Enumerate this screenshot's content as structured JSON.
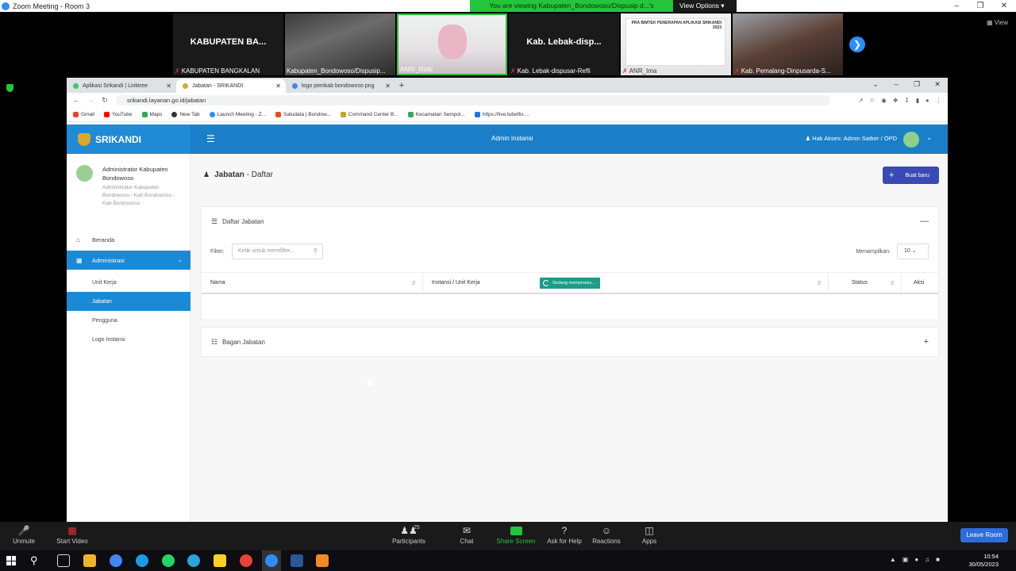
{
  "zoom": {
    "title": "Zoom Meeting - Room 3",
    "share_banner": "You are viewing Kabupaten_Bondowoso/Dispusip d...'s screen",
    "view_options": "View Options",
    "view_label": "View",
    "participants": [
      {
        "big_label": "KABUPATEN BA...",
        "caption": "KABUPATEN BANGKALAN"
      },
      {
        "big_label": "",
        "caption": "Kabupaten_Bondowoso/Dispusip..."
      },
      {
        "big_label": "",
        "caption": "ANRI_Rizki"
      },
      {
        "big_label": "Kab.  Lebak-disp...",
        "caption": "Kab. Lebak-dispusar-Refli"
      },
      {
        "big_label": "",
        "caption": "ANR_Ima"
      },
      {
        "big_label": "",
        "caption": "Kab. Pemalang-Dinpusarda-S..."
      }
    ],
    "poster_text": "PRA BIMTEK PENERAPAN APLIKASI SRIKANDI 2023",
    "toolbar": {
      "unmute": "Unmute",
      "start_video": "Start Video",
      "participants": "Participants",
      "participants_count": "25",
      "chat": "Chat",
      "share_screen": "Share Screen",
      "ask_for_help": "Ask for Help",
      "reactions": "Reactions",
      "apps": "Apps",
      "leave": "Leave Room"
    }
  },
  "browser": {
    "tabs": [
      {
        "label": "Aplikasi Srikandi | Linktree",
        "color": "#43c66a"
      },
      {
        "label": "Jabatan - SRIKANDI",
        "color": "#d8a92a"
      },
      {
        "label": "logo pemkab bondowoso png",
        "color": "#4285f4"
      }
    ],
    "url": "srikandi.layanan.go.id/jabatan",
    "bookmarks": [
      {
        "label": "Gmail",
        "color": "#ea4335"
      },
      {
        "label": "YouTube",
        "color": "#ff0000"
      },
      {
        "label": "Maps",
        "color": "#34a853"
      },
      {
        "label": "New Tab",
        "color": "#333333"
      },
      {
        "label": "Launch Meeting - Z...",
        "color": "#2d8cff"
      },
      {
        "label": "Satudata | Bondow...",
        "color": "#e94e1b"
      },
      {
        "label": "Command Center B...",
        "color": "#c9a227"
      },
      {
        "label": "Kecamatan Sempol...",
        "color": "#34a853"
      },
      {
        "label": "https://live.tubeflix....",
        "color": "#1a73e8"
      }
    ]
  },
  "app": {
    "brand": "SRIKANDI",
    "nav_center": "Admin Instansi",
    "hak_akses": "Hak Akses: Admin Satker / OPD",
    "user_name": "Administrator Kabupaten Bondowoso",
    "user_sub": "Administrator Kabupaten Bondowoso - Kab Bondowoso - Kab Bondowoso",
    "menu": {
      "beranda": "Beranda",
      "administrasi": "Administrasi",
      "sub": [
        "Unit Kerja",
        "Jabatan",
        "Pengguna",
        "Logo Instansi"
      ]
    },
    "page_title_bold": "Jabatan",
    "page_title_rest": " - Daftar",
    "new_button": "Buat baru",
    "list_card_title": "Daftar Jabatan",
    "filter_label": "Filter:",
    "filter_placeholder": "Ketik untuk memfilter...",
    "show_label": "Menampilkan:",
    "show_value": "10",
    "columns": [
      "Nama",
      "Instansi / Unit Kerja",
      "Status",
      "Aksi"
    ],
    "processing": "Sedang memproses...",
    "chart_card_title": "Bagan Jabatan"
  },
  "taskbar": {
    "time": "10:54",
    "date": "30/05/2023"
  }
}
